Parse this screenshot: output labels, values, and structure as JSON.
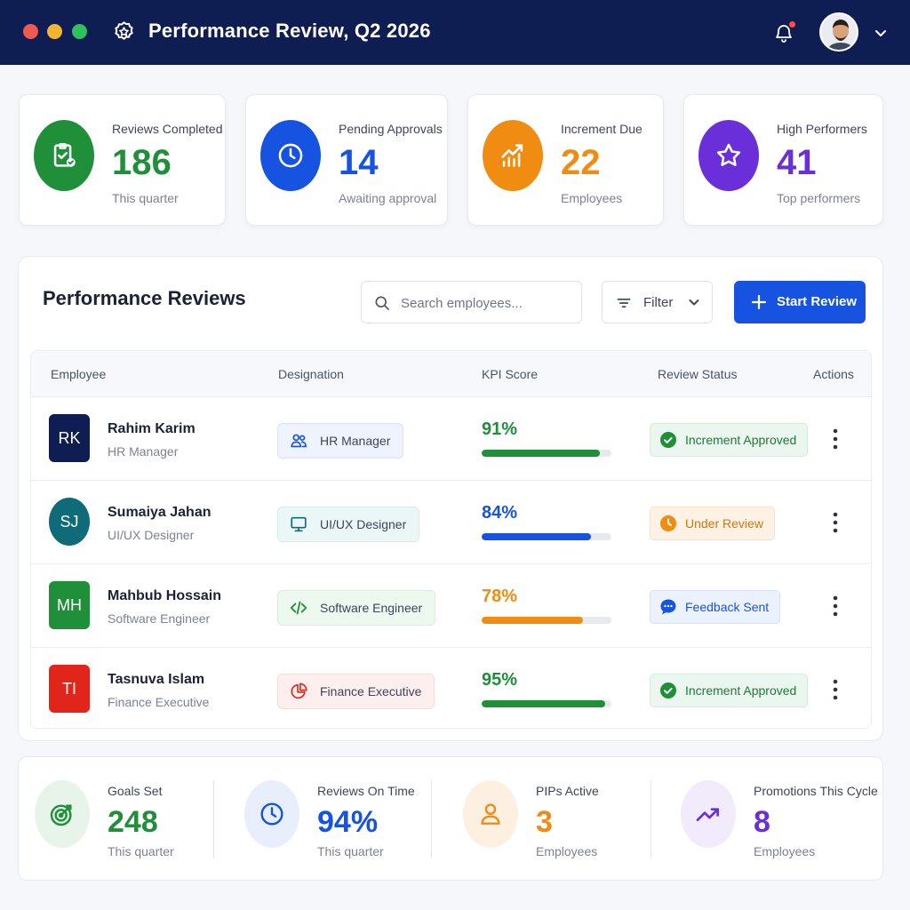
{
  "window": {
    "title": "Performance Review, Q2 2026",
    "logo_icon": "award-badge-icon",
    "notification_icon": "bell-icon",
    "notification_badge_color": "#ff4b4b",
    "avatar_icon": "user-avatar",
    "menu_icon": "chevron-down-icon"
  },
  "stats": [
    {
      "label": "Reviews Completed",
      "value": "186",
      "sub": "This quarter",
      "icon": "clipboard-check-icon",
      "color": "#1f8f3a"
    },
    {
      "label": "Pending Approvals",
      "value": "14",
      "sub": "Awaiting approval",
      "icon": "clock-icon",
      "color": "#1553e0"
    },
    {
      "label": "Increment Due",
      "value": "22",
      "sub": "Employees",
      "icon": "chart-trend-icon",
      "color": "#f08c12"
    },
    {
      "label": "High Performers",
      "value": "41",
      "sub": "Top performers",
      "icon": "star-icon",
      "color": "#6a2fd8"
    }
  ],
  "reviews": {
    "title": "Performance Reviews",
    "search_placeholder": "Search employees...",
    "filter_label": "Filter",
    "start_button": "Start Review",
    "columns": [
      "Employee",
      "Designation",
      "KPI Score",
      "Review Status",
      "Actions"
    ],
    "rows": [
      {
        "initials": "RK",
        "name": "Rahim Karim",
        "role": "HR Manager",
        "designation": "HR Manager",
        "designation_icon": "users-icon",
        "kpi": "91%",
        "kpi_value": 0.91,
        "kpi_color": "#1f8f3a",
        "status": "Increment Approved",
        "status_icon": "check-circle-icon",
        "status_color": "#1f8f3a"
      },
      {
        "initials": "SJ",
        "name": "Sumaiya Jahan",
        "role": "UI/UX Designer",
        "designation": "UI/UX Designer",
        "designation_icon": "monitor-icon",
        "kpi": "84%",
        "kpi_value": 0.84,
        "kpi_color": "#1553e0",
        "status": "Under Review",
        "status_icon": "clock-icon",
        "status_color": "#f08c12"
      },
      {
        "initials": "MH",
        "name": "Mahbub Hossain",
        "role": "Software Engineer",
        "designation": "Software Engineer",
        "designation_icon": "code-icon",
        "kpi": "78%",
        "kpi_value": 0.78,
        "kpi_color": "#f08c12",
        "status": "Feedback Sent",
        "status_icon": "chat-icon",
        "status_color": "#1553e0"
      },
      {
        "initials": "TI",
        "name": "Tasnuva Islam",
        "role": "Finance Executive",
        "designation": "Finance Executive",
        "designation_icon": "pie-chart-icon",
        "kpi": "95%",
        "kpi_value": 0.95,
        "kpi_color": "#1f8f3a",
        "status": "Increment Approved",
        "status_icon": "check-circle-icon",
        "status_color": "#1f8f3a"
      }
    ]
  },
  "summary": [
    {
      "label": "Goals Set",
      "value": "248",
      "sub": "This quarter",
      "icon": "target-icon",
      "color": "#1f8f3a"
    },
    {
      "label": "Reviews On Time",
      "value": "94%",
      "sub": "This quarter",
      "icon": "clock-icon",
      "color": "#1553e0"
    },
    {
      "label": "PIPs Active",
      "value": "3",
      "sub": "Employees",
      "icon": "person-icon",
      "color": "#f08c12"
    },
    {
      "label": "Promotions This Cycle",
      "value": "8",
      "sub": "Employees",
      "icon": "trend-up-icon",
      "color": "#6a2fd8"
    }
  ]
}
